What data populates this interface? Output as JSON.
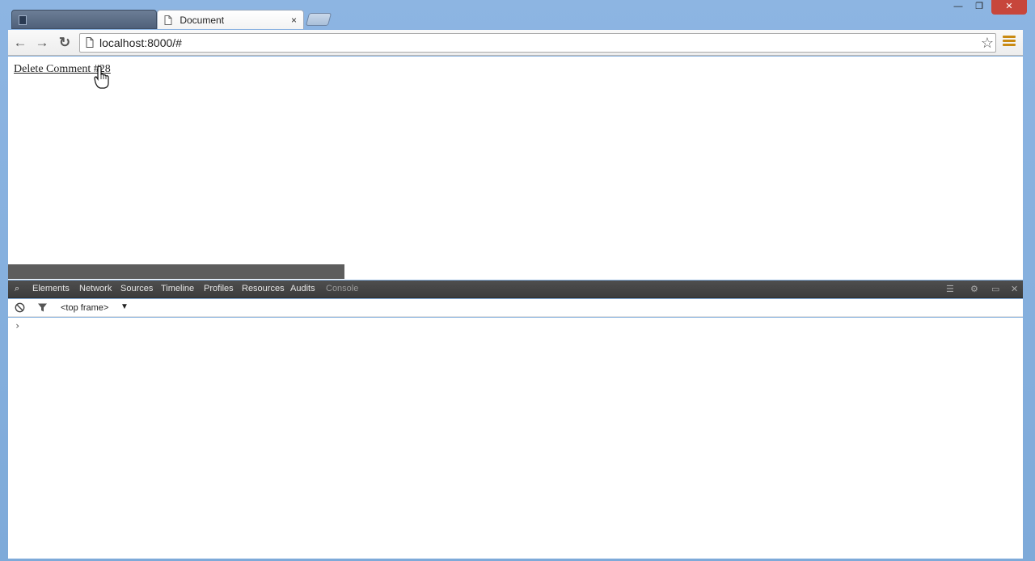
{
  "window": {
    "tabs": [
      {
        "title": "",
        "active": false
      },
      {
        "title": "Document",
        "active": true
      }
    ],
    "close_glyph": "×",
    "controls": {
      "minimize": "—",
      "maximize": "❐",
      "close": "✕"
    }
  },
  "toolbar": {
    "back_icon": "←",
    "forward_icon": "→",
    "reload_icon": "↻",
    "url": "localhost:8000/#",
    "bookmark_icon": "☆"
  },
  "page": {
    "link_text": "Delete Comment #28"
  },
  "devtools": {
    "tabs": [
      "Elements",
      "Network",
      "Sources",
      "Timeline",
      "Profiles",
      "Resources",
      "Audits",
      "Console"
    ],
    "selected_tab": "Console",
    "frame_selector": "<top frame>",
    "frame_arrow": "▼",
    "prompt": "›"
  },
  "colors": {
    "accent_menu": "#c98a12",
    "devtools_bar": "#3c3c3c"
  }
}
